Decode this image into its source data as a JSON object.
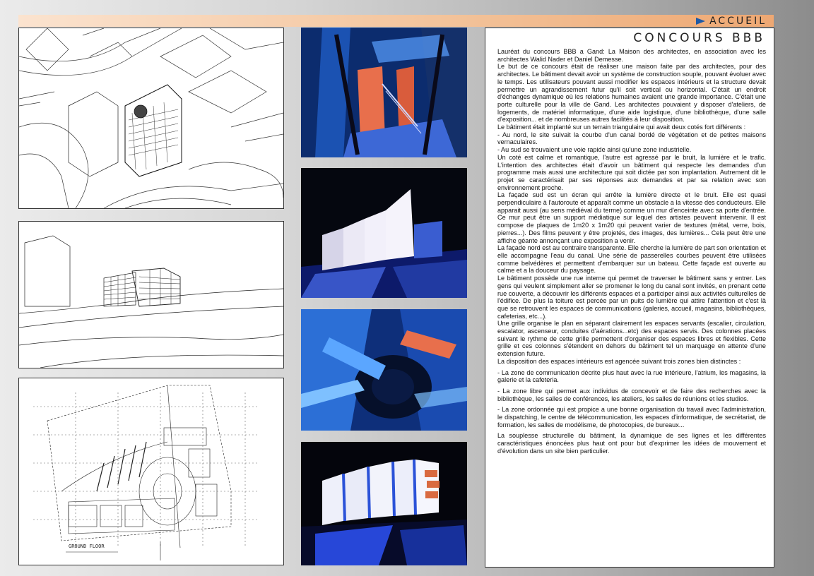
{
  "header": {
    "home_label": "ACCUEIL",
    "arrow_icon": "play-arrow-icon",
    "accent_color": "#1f5aa6"
  },
  "article": {
    "title": "CONCOURS BBB",
    "paragraphs": [
      "Lauréat du concours BBB a Gand: La Maison des architectes, en association avec les architectes Walid Nader et Daniel Demesse.",
      "Le but de ce concours était de réaliser une maison faite par des architectes, pour des architectes. Le bâtiment devait avoir un système de construction souple, pouvant évoluer avec le temps. Les utilisateurs pouvant aussi modifier les espaces intérieurs et la structure devait permettre un agrandissement futur qu'il soit vertical ou horizontal. C'était un endroit d'échanges dynamique où les relations humaines avaient une grande importance. C'était une porte culturelle pour la ville de Gand. Les architectes pouvaient y disposer d'ateliers, de logements, de matériel informatique, d'une aide logistique, d'une bibliothèque, d'une salle d'exposition... et de nombreuses autres facilités à leur disposition.",
      "Le bâtiment était implanté sur un terrain triangulaire qui avait deux cotés fort différents :",
      "- Au nord, le site suivait la courbe d'un canal bordé de végétation et de petites maisons vernaculaires.",
      "- Au sud se trouvaient une voie rapide ainsi qu'une zone industrielle.",
      "Un coté est calme et romantique, l'autre est agressé par le bruit, la lumière et le trafic. L'intention des architectes était d'avoir un bâtiment qui respecte les demandes d'un programme mais aussi une architecture qui soit dictée par son implantation. Autrement dit le projet se caractérisait par ses réponses aux demandes et par sa relation avec son environnement proche.",
      "La façade sud est un écran qui arrête la lumière directe et le bruit. Elle est quasi perpendiculaire à l'autoroute et apparaît comme un obstacle a la vitesse des conducteurs. Elle apparait aussi (au sens médiéval du terme) comme un mur d'enceinte avec sa porte d'entrée. Ce mur peut être un support médiatique sur lequel des artistes peuvent intervenir. Il est compose de plaques de 1m20 x 1m20 qui peuvent varier de textures (métal, verre, bois, pierres...). Des films peuvent y être projetés, des images, des lumières... Cela peut être une affiche géante annonçant une exposition a venir.",
      "La façade nord est au contraire transparente. Elle cherche la lumière de part son orientation et elle accompagne l'eau du canal. Une série de passerelles courbes peuvent être utilisées comme belvédères et permettent d'embarquer sur un bateau. Cette façade est ouverte au calme et a la douceur du paysage.",
      "Le bâtiment possède une rue interne qui permet de traverser le bâtiment sans y entrer. Les gens qui veulent simplement aller se promener le long du canal sont invités, en prenant cette rue couverte, a découvrir les différents espaces et a participer ainsi aux activités culturelles de l'édifice. De plus la toiture est percée par un puits de lumière qui attire l'attention et c'est là que se retrouvent les espaces de communications (galeries, accueil, magasins, bibliothèques, cafeterias, etc...).",
      "Une grille organise le plan en séparant clairement les espaces servants (escalier, circulation, escalator, ascenseur, conduites d'aérations...etc) des espaces servis. Des colonnes placées suivant le rythme de cette grille permettent d'organiser des espaces libres et flexibles. Cette grille et ces colonnes s'étendent en dehors du bâtiment tel un marquage en attente d'une extension future.",
      "La disposition des espaces intérieurs est agencée suivant trois zones bien distinctes :",
      "- La zone de communication décrite plus haut avec la rue intérieure, l'atrium, les magasins, la galerie et la cafeteria.",
      "- La zone libre qui permet aux individus de concevoir et de faire des recherches avec la bibliothèque, les salles de conférences, les ateliers, les salles de réunions et les studios.",
      "- La zone ordonnée qui est propice a une bonne organisation du travail avec l'administration, le dispatching, le centre de télécommunication, les espaces d'informatique, de secrétariat, de formation, les salles de modélisme, de photocopies, de bureaux...",
      "La souplesse structurelle du bâtiment, la dynamique de ses lignes et les différentes caractéristiques énoncées plus haut ont pour but d'exprimer les idées de mouvement et d'évolution dans un site bien particulier."
    ]
  },
  "drawings": {
    "floor_plan_caption": "GROUND FLOOR"
  }
}
